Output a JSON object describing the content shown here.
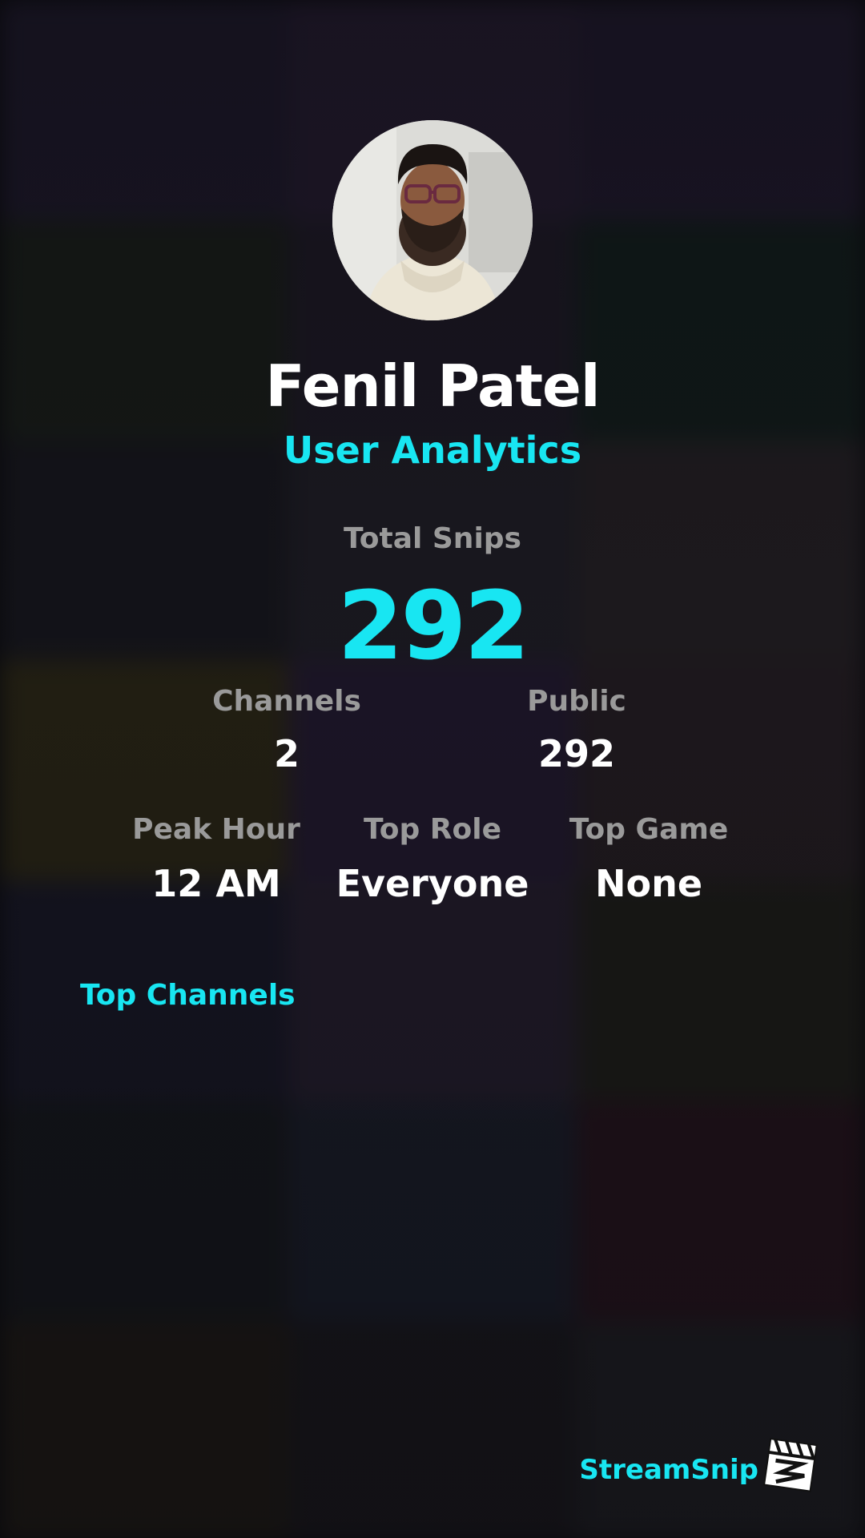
{
  "profile": {
    "name": "Fenil Patel",
    "subtitle": "User Analytics"
  },
  "total": {
    "label": "Total Snips",
    "value": "292"
  },
  "stats_row1": [
    {
      "label": "Channels",
      "value": "2"
    },
    {
      "label": "Public",
      "value": "292"
    }
  ],
  "stats_row2": [
    {
      "label": "Peak Hour",
      "value": "12 AM"
    },
    {
      "label": "Top Role",
      "value": "Everyone"
    },
    {
      "label": "Top Game",
      "value": "None"
    }
  ],
  "sections": {
    "top_channels": "Top Channels"
  },
  "brand": {
    "name": "StreamSnip",
    "logo_icon": "clapperboard-icon"
  },
  "colors": {
    "accent": "#18e6f2",
    "label": "#9a9a9a",
    "value": "#ffffff",
    "background": "#0a0a0d"
  }
}
